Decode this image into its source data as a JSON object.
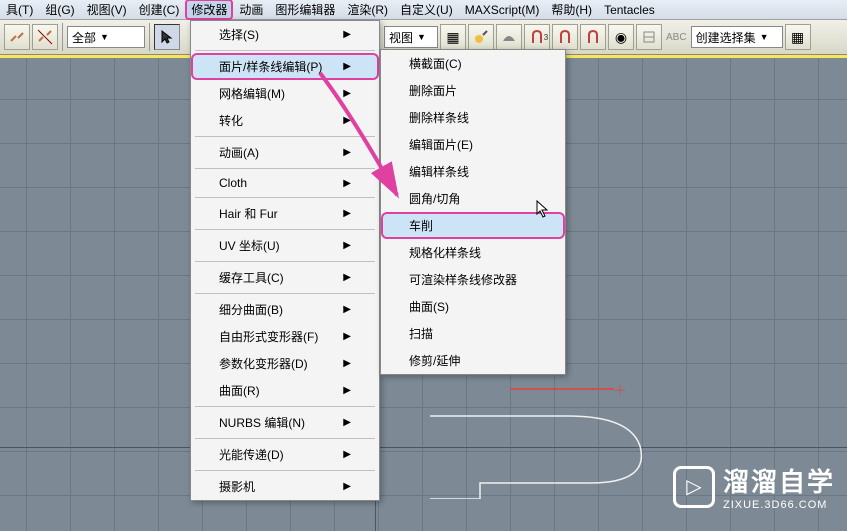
{
  "menubar": {
    "items": [
      {
        "label": "具(T)"
      },
      {
        "label": "组(G)"
      },
      {
        "label": "视图(V)"
      },
      {
        "label": "创建(C)"
      },
      {
        "label": "修改器"
      },
      {
        "label": "动画"
      },
      {
        "label": "图形编辑器"
      },
      {
        "label": "渲染(R)"
      },
      {
        "label": "自定义(U)"
      },
      {
        "label": "MAXScript(M)"
      },
      {
        "label": "帮助(H)"
      },
      {
        "label": "Tentacles"
      }
    ]
  },
  "toolbar": {
    "dropdown1": "全部",
    "dropdown2": "视图",
    "dropdown3": "创建选择集"
  },
  "modifiers_menu": {
    "items": [
      {
        "label": "选择(S)",
        "sub": true
      },
      {
        "label": "面片/样条线编辑(P)",
        "sub": true,
        "hovered": true,
        "highlighted": true
      },
      {
        "label": "网格编辑(M)",
        "sub": true
      },
      {
        "label": "转化",
        "sub": true
      },
      {
        "label": "动画(A)",
        "sub": true
      },
      {
        "label": "Cloth",
        "sub": true
      },
      {
        "label": "Hair 和 Fur",
        "sub": true
      },
      {
        "label": "UV 坐标(U)",
        "sub": true
      },
      {
        "label": "缓存工具(C)",
        "sub": true
      },
      {
        "label": "细分曲面(B)",
        "sub": true
      },
      {
        "label": "自由形式变形器(F)",
        "sub": true
      },
      {
        "label": "参数化变形器(D)",
        "sub": true
      },
      {
        "label": "曲面(R)",
        "sub": true
      },
      {
        "label": "NURBS 编辑(N)",
        "sub": true
      },
      {
        "label": "光能传递(D)",
        "sub": true
      },
      {
        "label": "摄影机",
        "sub": true
      }
    ]
  },
  "submenu": {
    "items": [
      {
        "label": "横截面(C)"
      },
      {
        "label": "删除面片"
      },
      {
        "label": "删除样条线"
      },
      {
        "label": "编辑面片(E)"
      },
      {
        "label": "编辑样条线"
      },
      {
        "label": "圆角/切角"
      },
      {
        "label": "车削",
        "hovered": true,
        "highlighted": true
      },
      {
        "label": "规格化样条线"
      },
      {
        "label": "可渲染样条线修改器"
      },
      {
        "label": "曲面(S)"
      },
      {
        "label": "扫描"
      },
      {
        "label": "修剪/延伸"
      }
    ]
  },
  "branding": {
    "title": "溜溜自学",
    "url": "ZIXUE.3D66.COM"
  }
}
